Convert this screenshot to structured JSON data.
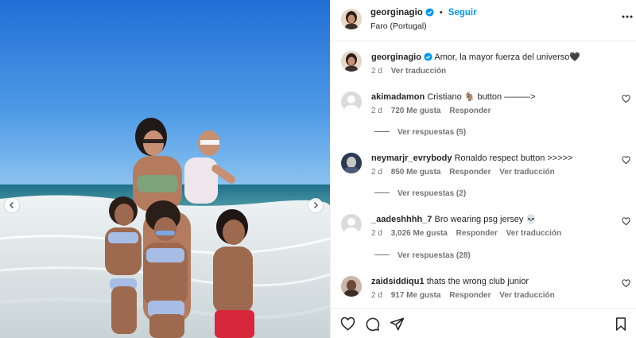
{
  "post": {
    "author": "georginagio",
    "follow_label": "Seguir",
    "location": "Faro (Portugal)",
    "caption": "Amor, la mayor fuerza del universo🖤",
    "caption_time": "2 d",
    "see_translation": "Ver traducción"
  },
  "comments": [
    {
      "user": "akimadamon",
      "text": "Cristiano 🐐 button ———>",
      "time": "2 d",
      "likes": "720 Me gusta",
      "reply": "Responder",
      "translate": "",
      "view_replies": "Ver respuestas (5)"
    },
    {
      "user": "neymarjr_evrybody",
      "text": "Ronaldo respect button >>>>>",
      "time": "2 d",
      "likes": "850 Me gusta",
      "reply": "Responder",
      "translate": "Ver traducción",
      "view_replies": "Ver respuestas (2)"
    },
    {
      "user": "_aadeshhhh_7",
      "text": "Bro wearing psg jersey 💀",
      "time": "2 d",
      "likes": "3,026 Me gusta",
      "reply": "Responder",
      "translate": "Ver traducción",
      "view_replies": "Ver respuestas (28)"
    },
    {
      "user": "zaidsiddiqu1",
      "text": "thats the wrong club junior",
      "time": "2 d",
      "likes": "917 Me gusta",
      "reply": "Responder",
      "translate": "Ver traducción",
      "view_replies": ""
    }
  ],
  "icons": {
    "verified": "verified-badge-icon",
    "more": "more-options-icon",
    "like": "heart-icon",
    "comment": "comment-icon",
    "share": "send-icon",
    "save": "bookmark-icon",
    "prev": "chevron-left-icon",
    "next": "chevron-right-icon"
  },
  "colors": {
    "accent": "#0095f6",
    "text": "#262626",
    "secondary": "#737373"
  }
}
